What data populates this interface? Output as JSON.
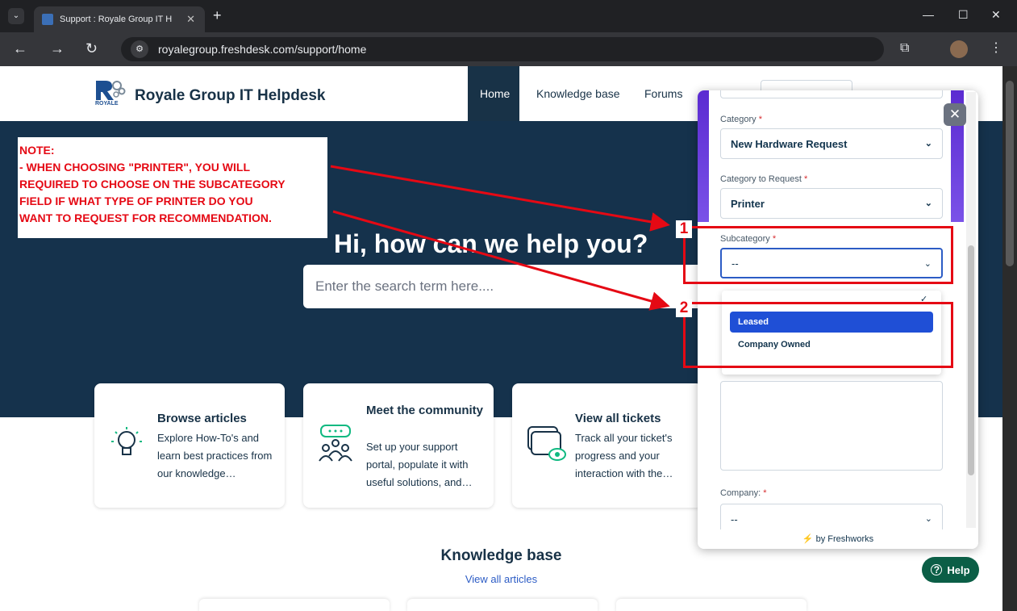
{
  "browser": {
    "tab_title": "Support : Royale Group IT H",
    "url": "royalegroup.freshdesk.com/support/home"
  },
  "site": {
    "title": "Royale Group IT Helpdesk",
    "logo_text": "ROYALE",
    "nav": [
      "Home",
      "Knowledge base",
      "Forums"
    ]
  },
  "hero": {
    "heading": "Hi, how can we help you?",
    "search_placeholder": "Enter the search term here...."
  },
  "note": {
    "lines": [
      "NOTE:",
      "- WHEN CHOOSING \"PRINTER\", YOU WILL",
      "REQUIRED TO CHOOSE ON THE SUBCATEGORY",
      "FIELD IF WHAT TYPE OF PRINTER DO YOU",
      "WANT TO REQUEST FOR RECOMMENDATION."
    ]
  },
  "cards": [
    {
      "title": "Browse articles",
      "desc": "Explore How-To's and learn best practices from our knowledge…",
      "icon": "lightbulb-icon"
    },
    {
      "title": "Meet the community",
      "desc": "Set up your support portal, populate it with useful solutions, and…",
      "icon": "community-icon"
    },
    {
      "title": "View all tickets",
      "desc": "Track all your ticket's progress and your interaction with the…",
      "icon": "tickets-icon"
    }
  ],
  "knowledge_base": {
    "title": "Knowledge base",
    "link": "View all articles"
  },
  "widget": {
    "category_label": "Category",
    "category_value": "New Hardware Request",
    "category_request_label": "Category to Request",
    "category_request_value": "Printer",
    "subcategory_label": "Subcategory",
    "subcategory_value": "--",
    "options": [
      "Leased",
      "Company Owned"
    ],
    "company_label": "Company:",
    "company_value": "--",
    "footer": "by Freshworks",
    "required_mark": "*"
  },
  "help_button": "Help",
  "annotations": {
    "marker_1": "1",
    "marker_2": "2",
    "color": "#e50914"
  }
}
